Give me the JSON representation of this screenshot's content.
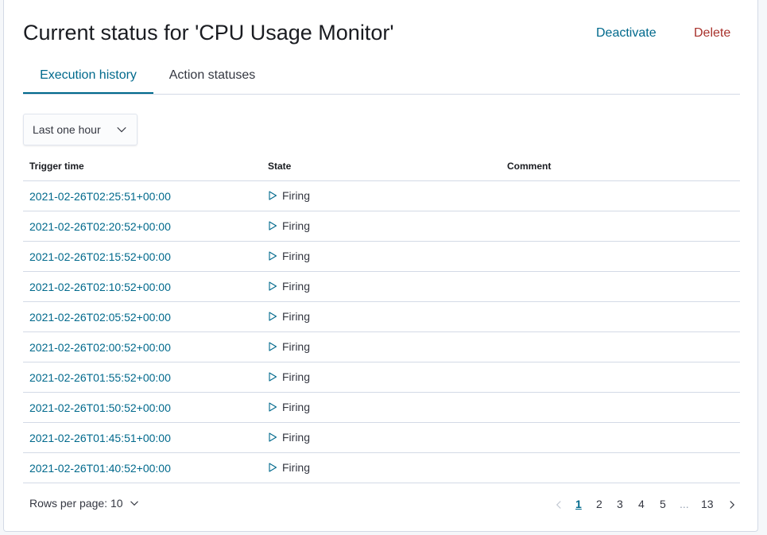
{
  "header": {
    "title": "Current status for 'CPU Usage Monitor'",
    "deactivate_label": "Deactivate",
    "delete_label": "Delete"
  },
  "tabs": [
    {
      "label": "Execution history",
      "selected": true
    },
    {
      "label": "Action statuses",
      "selected": false
    }
  ],
  "filter": {
    "time_range": "Last one hour"
  },
  "table": {
    "columns": [
      "Trigger time",
      "State",
      "Comment"
    ],
    "rows": [
      {
        "trigger_time": "2021-02-26T02:25:51+00:00",
        "state": "Firing",
        "comment": ""
      },
      {
        "trigger_time": "2021-02-26T02:20:52+00:00",
        "state": "Firing",
        "comment": ""
      },
      {
        "trigger_time": "2021-02-26T02:15:52+00:00",
        "state": "Firing",
        "comment": ""
      },
      {
        "trigger_time": "2021-02-26T02:10:52+00:00",
        "state": "Firing",
        "comment": ""
      },
      {
        "trigger_time": "2021-02-26T02:05:52+00:00",
        "state": "Firing",
        "comment": ""
      },
      {
        "trigger_time": "2021-02-26T02:00:52+00:00",
        "state": "Firing",
        "comment": ""
      },
      {
        "trigger_time": "2021-02-26T01:55:52+00:00",
        "state": "Firing",
        "comment": ""
      },
      {
        "trigger_time": "2021-02-26T01:50:52+00:00",
        "state": "Firing",
        "comment": ""
      },
      {
        "trigger_time": "2021-02-26T01:45:51+00:00",
        "state": "Firing",
        "comment": ""
      },
      {
        "trigger_time": "2021-02-26T01:40:52+00:00",
        "state": "Firing",
        "comment": ""
      }
    ]
  },
  "footer": {
    "rows_per_page_label": "Rows per page: 10",
    "pages": [
      "1",
      "2",
      "3",
      "4",
      "5",
      "...",
      "13"
    ],
    "current_page": "1"
  },
  "icons": {
    "select_chevron": "chevron-down-icon",
    "state": "play-icon",
    "prev": "chevron-left-icon",
    "next": "chevron-right-icon"
  },
  "colors": {
    "link": "#00698c",
    "danger": "#a8322c",
    "border": "#d3dae6",
    "text": "#343741"
  }
}
